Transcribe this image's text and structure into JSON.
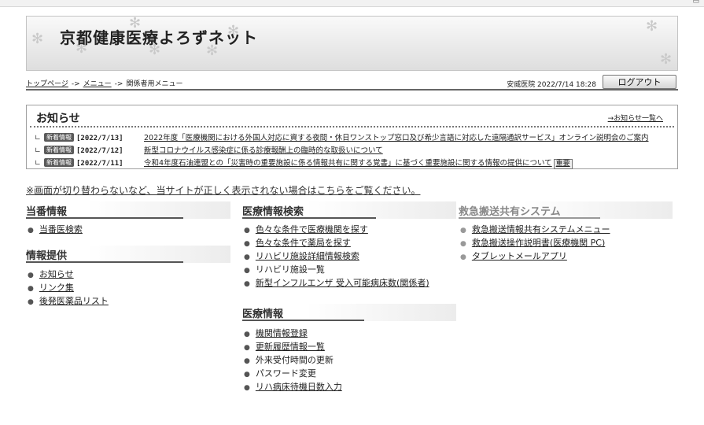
{
  "header": {
    "site_title": "京都健康医療よろずネット"
  },
  "breadcrumb": {
    "items": [
      "トップページ",
      "メニュー",
      "関係者用メニュー"
    ],
    "separator": "->"
  },
  "user": {
    "info": "安威医院  2022/7/14 18:28",
    "logout_label": "ログアウト"
  },
  "news": {
    "title": "お知らせ",
    "all_link": "→お知らせ一覧へ",
    "items": [
      {
        "badge": "新着情報",
        "date": "[2022/7/13]",
        "text": "2022年度「医療機関における外国人対応に資する夜間・休日ワンストップ窓口及び希少言語に対応した遠隔通訳サービス」オンライン説明会のご案内",
        "tag": ""
      },
      {
        "badge": "新着情報",
        "date": "[2022/7/12]",
        "text": "新型コロナウイルス感染症に係る診療報酬上の臨時的な取扱いについて",
        "tag": ""
      },
      {
        "badge": "新着情報",
        "date": "[2022/7/11]",
        "text": "令和4年度石油連盟との「災害時の重要施設に係る情報共有に関する覚書」に基づく重要施設に関する情報の提供について",
        "tag": "重要"
      }
    ]
  },
  "notice": "※画面が切り替わらないなど、当サイトが正しく表示されない場合はこちらをご覧ください。",
  "sections": {
    "duty": {
      "title": "当番情報",
      "items": [
        "当番医検索"
      ]
    },
    "info": {
      "title": "情報提供",
      "items": [
        "お知らせ",
        "リンク集",
        "後発医薬品リスト"
      ]
    },
    "search": {
      "title": "医療情報検索",
      "items": [
        "色々な条件で医療機関を探す",
        "色々な条件で薬局を探す",
        "リハビリ施設詳細情報検索",
        "リハビリ施設一覧",
        "新型インフルエンザ 受入可能病床数(関係者)"
      ]
    },
    "medical": {
      "title": "医療情報",
      "items": [
        "機関情報登録",
        "更新履歴情報一覧",
        "外来受付時間の更新",
        "パスワード変更",
        "リハ病床待機日数入力"
      ]
    },
    "emergency": {
      "title": "救急搬送共有システム",
      "items": [
        "救急搬送情報共有システムメニュー",
        "救急搬送操作説明書(医療機関 PC)",
        "タブレットメールアプリ"
      ]
    }
  }
}
